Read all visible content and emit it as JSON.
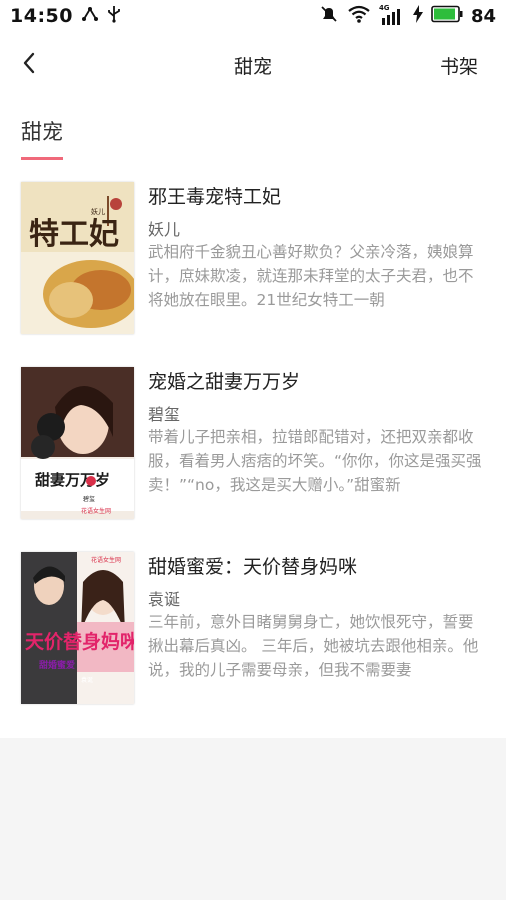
{
  "status": {
    "time": "14:50",
    "network": "4G",
    "battery": "84",
    "battery_color": "#2ebd3c"
  },
  "nav": {
    "title": "甜宠",
    "action": "书架",
    "back_icon": "chevron-left-icon"
  },
  "section": {
    "title": "甜宠",
    "accent": "#f0697a"
  },
  "books": [
    {
      "title": "邪王毒宠特工妃",
      "author": "妖儿",
      "desc": "武相府千金貌丑心善好欺负？父亲冷落，姨娘算计，庶妹欺凌，就连那未拜堂的太子夫君，也不将她放在眼里。21世纪女特工一朝",
      "cover_title": "特工妃",
      "cover_author": "妖儿"
    },
    {
      "title": "宠婚之甜妻万万岁",
      "author": "碧玺",
      "desc": "带着儿子把亲相，拉错郎配错对，还把双亲都收服，看着男人痞痞的坏笑。“你你，你这是强买强卖！”“no，我这是买大赠小。”甜蜜新",
      "cover_title": "甜妻万万岁",
      "cover_author": "碧玺",
      "cover_badge": "花语女生网"
    },
    {
      "title": "甜婚蜜爱：天价替身妈咪",
      "author": "袁诞",
      "desc": "三年前，意外目睹舅舅身亡，她饮恨死守，誓要揪出幕后真凶。 三年后，她被坑去跟他相亲。他说，我的儿子需要母亲，但我不需要妻",
      "cover_title": "天价替身妈咪",
      "cover_subtitle": "甜婚蜜爱",
      "cover_author": "袁诞",
      "cover_badge": "花语女生网"
    }
  ]
}
